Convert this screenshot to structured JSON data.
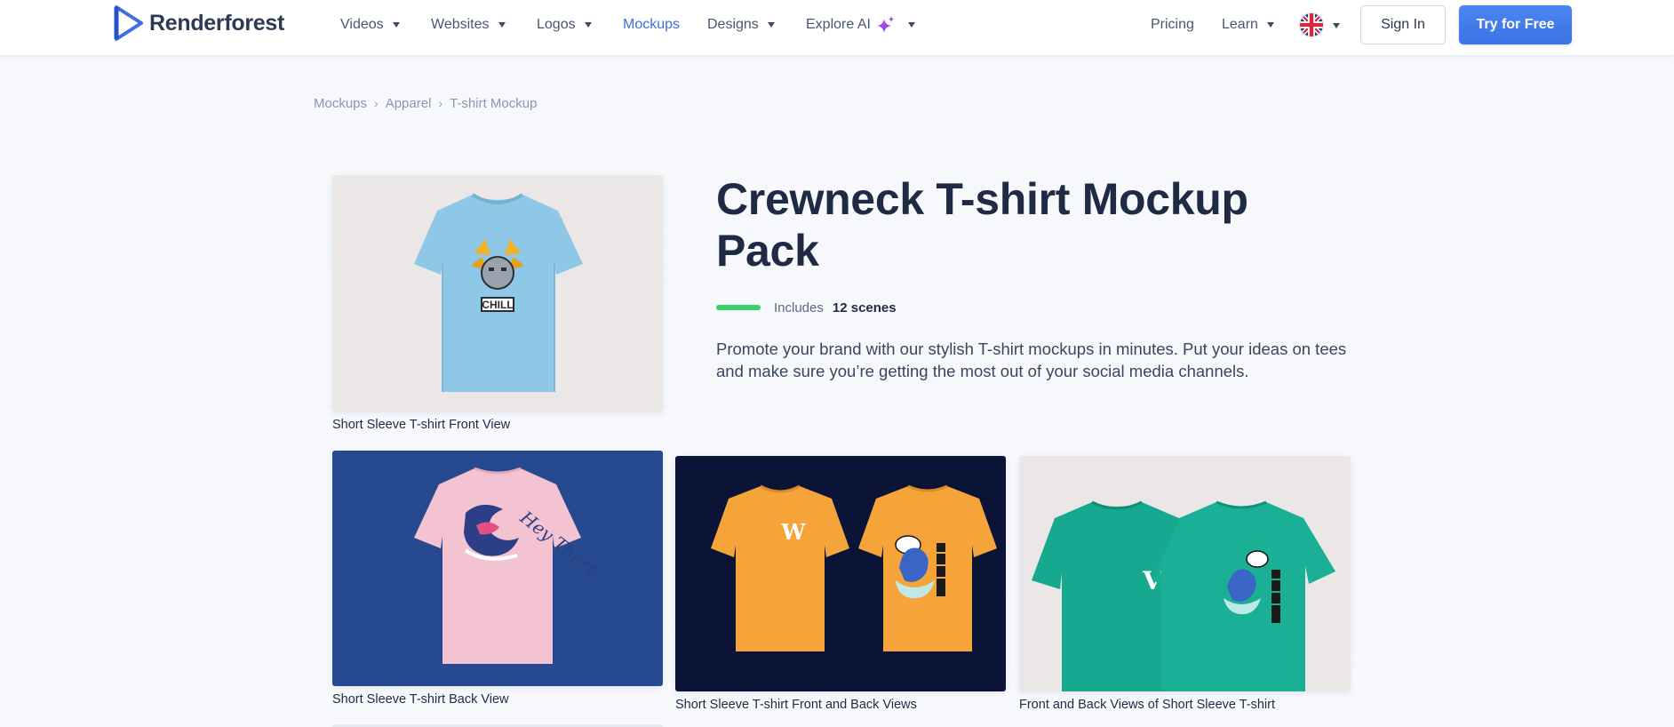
{
  "header": {
    "logo_text": "Renderforest",
    "nav": [
      {
        "label": "Videos",
        "has_caret": true
      },
      {
        "label": "Websites",
        "has_caret": true
      },
      {
        "label": "Logos",
        "has_caret": true
      },
      {
        "label": "Mockups",
        "has_caret": false,
        "active": true
      },
      {
        "label": "Designs",
        "has_caret": true
      },
      {
        "label": "Explore AI",
        "has_caret": true
      }
    ],
    "right_nav": [
      {
        "label": "Pricing"
      },
      {
        "label": "Learn"
      }
    ],
    "language_icon": "uk-flag-icon",
    "sign_in_label": "Sign In",
    "try_label": "Try for Free"
  },
  "breadcrumb": [
    "Mockups",
    "Apparel",
    "T-shirt Mockup"
  ],
  "product": {
    "title": "Crewneck T-shirt Mockup Pack",
    "includes_label": "Includes",
    "scenes_label": "12 scenes",
    "description": "Promote your brand with our stylish T-shirt mockups in minutes. Put your ideas on tees and make sure you’re getting the most out of your social media channels."
  },
  "cards": [
    {
      "caption": "Short Sleeve T-shirt Front View",
      "shirt_color": "#8ec8e6",
      "bg_color": "#ebe7e6",
      "print_text": "CHILL"
    },
    {
      "caption": "Short Sleeve T-shirt Back View",
      "shirt_color": "#f4c3d2",
      "bg_color": "#27498f",
      "print_text": "Hey There"
    },
    {
      "caption": "Short Sleeve T-shirt Front and Back Views",
      "shirt_color": "#f5a43a",
      "bg_color": "#0b1437",
      "print_text": "W"
    },
    {
      "caption": "Front and Back Views of Short Sleeve T-shirt",
      "shirt_color": "#17a890",
      "bg_color": "#ebe7e6",
      "print_text": "V"
    }
  ],
  "colors": {
    "accent": "#3f6fd8",
    "button_primary": "#3a73e6",
    "green_bar": "#3bd06a",
    "text_dark": "#1f2a44"
  }
}
